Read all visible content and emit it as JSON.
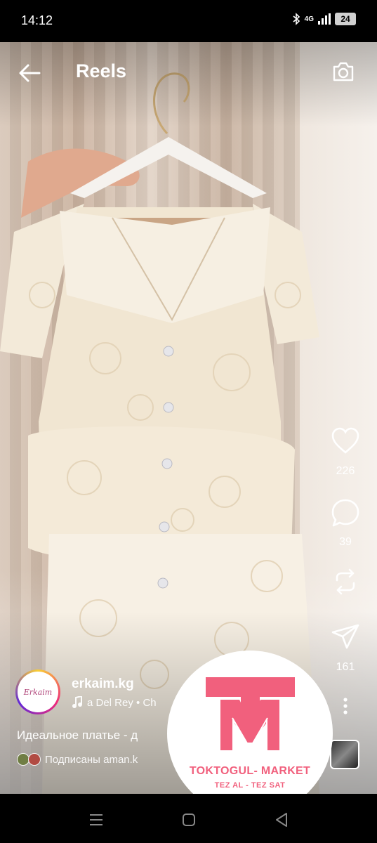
{
  "status_bar": {
    "time": "14:12",
    "network": "4G",
    "battery": "24"
  },
  "header": {
    "title": "Reels"
  },
  "actions": {
    "likes": "226",
    "comments": "39",
    "shares": "161"
  },
  "post": {
    "username": "erkaim.kg",
    "avatar_text": "Erkaim",
    "music": "a Del Rey • Ch",
    "caption": "Идеальное платье - д",
    "followers_text": "Подписаны aman.k"
  },
  "watermark": {
    "letter": "M",
    "name": "TOKTOGUL- MARKET",
    "slogan": "TEZ AL - TEZ SAT",
    "color": "#f1607d"
  },
  "colors": {
    "accent": "#f1607d",
    "background": "#000000"
  }
}
